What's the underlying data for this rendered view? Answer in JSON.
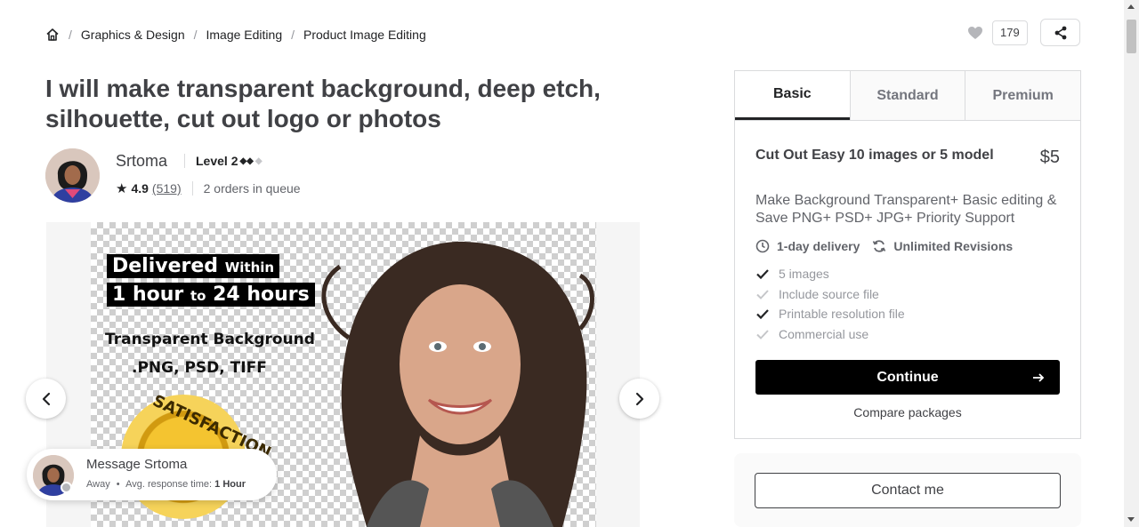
{
  "breadcrumb": {
    "items": [
      "Graphics & Design",
      "Image Editing",
      "Product Image Editing"
    ],
    "separator": "/"
  },
  "actions": {
    "like_count": "179"
  },
  "title": "I will make transparent background, deep etch, silhouette, cut out logo or photos",
  "seller": {
    "name": "Srtoma",
    "level": "Level 2",
    "level_diamonds": "◆◆",
    "level_diamond_off": "◆",
    "star": "★",
    "rating": "4.9",
    "reviews": "(519)",
    "queue": "2 orders in queue"
  },
  "gallery": {
    "banner_line1_big": "Delivered",
    "banner_line1_small": "Within",
    "banner_line2_a": "1 hour",
    "banner_line2_b": "to",
    "banner_line2_c": "24 hours",
    "promo_line1": "Transparent Background",
    "promo_line2": ".PNG, PSD, TIFF",
    "seal_text": "SATISFACTION"
  },
  "message": {
    "title": "Message Srtoma",
    "status": "Away",
    "bullet": "•",
    "response_label": "Avg. response time:",
    "response_value": "1 Hour"
  },
  "packages": {
    "tabs": [
      "Basic",
      "Standard",
      "Premium"
    ],
    "active_tab": "Basic",
    "name": "Cut Out Easy 10 images or 5 model",
    "price": "$5",
    "description": "Make Background Transparent+ Basic editing & Save PNG+ PSD+ JPG+ Priority Support",
    "delivery": "1-day delivery",
    "revisions": "Unlimited Revisions",
    "features": [
      {
        "label": "5 images",
        "included": true
      },
      {
        "label": "Include source file",
        "included": false
      },
      {
        "label": "Printable resolution file",
        "included": true
      },
      {
        "label": "Commercial use",
        "included": false
      }
    ],
    "continue_label": "Continue",
    "compare_label": "Compare packages"
  },
  "contact": {
    "label": "Contact me"
  },
  "icons": {
    "home": "home-icon",
    "heart": "heart-icon",
    "share": "share-icon",
    "clock": "clock-icon",
    "refresh": "refresh-icon",
    "check": "check-icon",
    "arrow_right": "arrow-right-icon",
    "chevron_left": "chevron-left-icon",
    "chevron_right": "chevron-right-icon"
  },
  "colors": {
    "text": "#404145",
    "muted": "#95979d",
    "check_on": "#222325",
    "check_off": "#c5c6c9",
    "button_bg": "#000000"
  }
}
